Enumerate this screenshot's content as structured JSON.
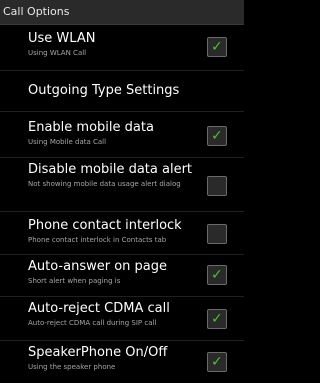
{
  "header": {
    "title": "Call Options"
  },
  "items": [
    {
      "title": "Use WLAN",
      "subtitle": "Using WLAN Call",
      "checked": true
    },
    {
      "title": "Outgoing Type Settings"
    },
    {
      "title": "Enable mobile data",
      "subtitle": "Using Mobile data Call",
      "checked": true
    },
    {
      "title": "Disable mobile data alert",
      "subtitle": "Not showing mobile data usage alert dialog",
      "checked": false
    },
    {
      "title": "Phone contact interlock",
      "subtitle": "Phone contact interlock in Contacts tab",
      "checked": false
    },
    {
      "title": "Auto-answer on page",
      "subtitle": "Short alert when paging is",
      "checked": true
    },
    {
      "title": "Auto-reject CDMA call",
      "subtitle": "Auto-reject CDMA call during SIP call",
      "checked": true
    },
    {
      "title": "SpeakerPhone On/Off",
      "subtitle": "Using the speaker phone",
      "checked": true
    }
  ],
  "icons": {
    "check": "check-icon"
  },
  "colors": {
    "check": "#4cbf2f",
    "background": "#000000",
    "header": "#2a2a2a"
  }
}
